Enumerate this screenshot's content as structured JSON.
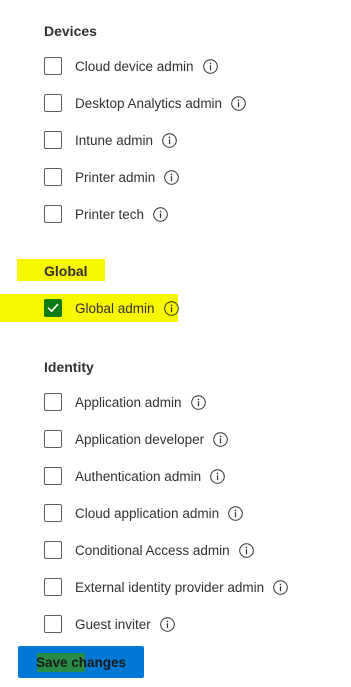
{
  "sections": [
    {
      "title": "Devices",
      "roles": [
        {
          "label": "Cloud device admin",
          "checked": false
        },
        {
          "label": "Desktop Analytics admin",
          "checked": false
        },
        {
          "label": "Intune admin",
          "checked": false
        },
        {
          "label": "Printer admin",
          "checked": false
        },
        {
          "label": "Printer tech",
          "checked": false
        }
      ]
    },
    {
      "title": "Global",
      "roles": [
        {
          "label": "Global admin",
          "checked": true
        }
      ]
    },
    {
      "title": "Identity",
      "roles": [
        {
          "label": "Application admin",
          "checked": false
        },
        {
          "label": "Application developer",
          "checked": false
        },
        {
          "label": "Authentication admin",
          "checked": false
        },
        {
          "label": "Cloud application admin",
          "checked": false
        },
        {
          "label": "Conditional Access admin",
          "checked": false
        },
        {
          "label": "External identity provider admin",
          "checked": false
        },
        {
          "label": "Guest inviter",
          "checked": false
        }
      ]
    }
  ],
  "footer": {
    "save_label": "Save changes"
  },
  "colors": {
    "accent": "#0078d4",
    "checked": "#107c10",
    "highlight": "#f7f700"
  }
}
